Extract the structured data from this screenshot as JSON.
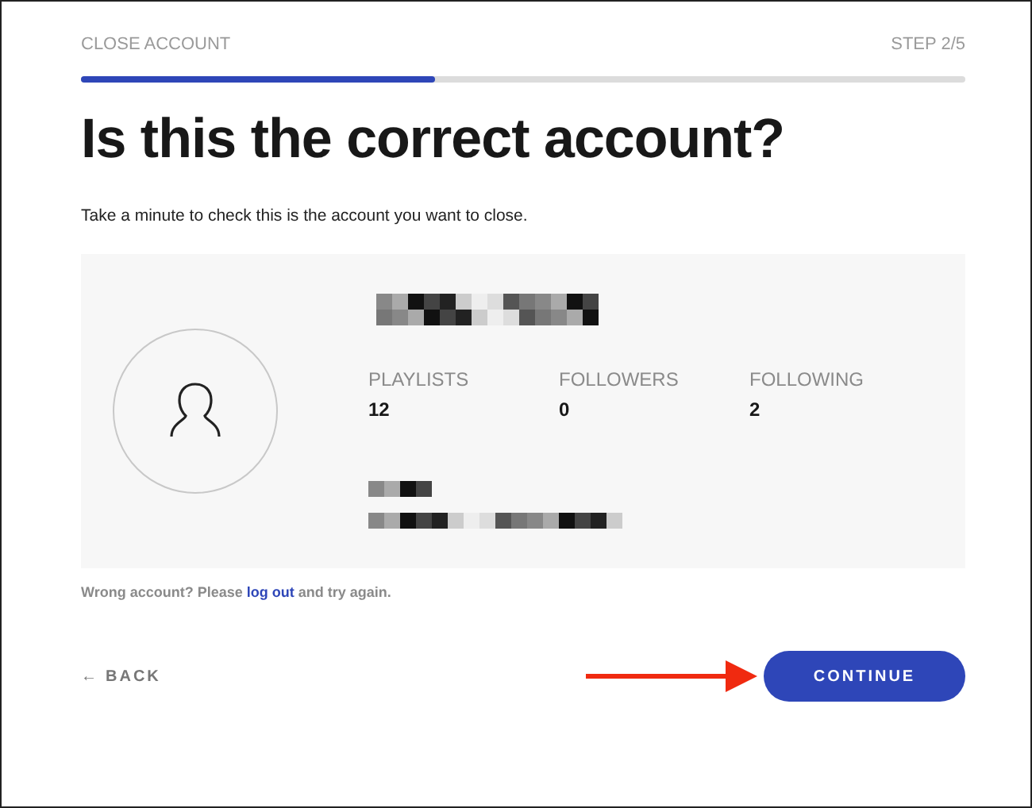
{
  "header": {
    "title": "CLOSE ACCOUNT",
    "step": "STEP 2/5"
  },
  "progress": {
    "level": 0.4
  },
  "heading": "Is this the correct account?",
  "intro": "Take a minute to check this is the account you want to close.",
  "stats": [
    {
      "label": "PLAYLISTS",
      "value": "12"
    },
    {
      "label": "FOLLOWERS",
      "value": "0"
    },
    {
      "label": "FOLLOWING",
      "value": "2"
    }
  ],
  "wrong_account": {
    "before": "Wrong account? Please ",
    "link": "log out",
    "after": " and try again."
  },
  "back": {
    "arrow": "←",
    "label": "BACK"
  },
  "continue": "CONTINUE"
}
